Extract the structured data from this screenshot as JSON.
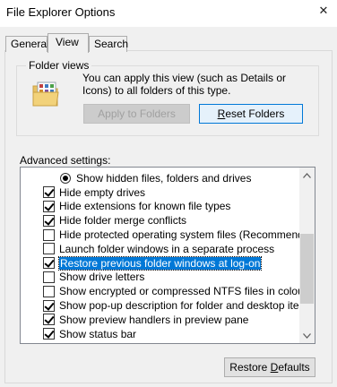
{
  "window": {
    "title": "File Explorer Options",
    "close_glyph": "✕"
  },
  "tabs": [
    {
      "label": "General",
      "active": false
    },
    {
      "label": "View",
      "active": true
    },
    {
      "label": "Search",
      "active": false
    }
  ],
  "folder_views": {
    "group_label": "Folder views",
    "description": "You can apply this view (such as Details or Icons) to all folders of this type.",
    "apply_button": {
      "label": "Apply to Folders",
      "enabled": false
    },
    "reset_button": {
      "prefix": "",
      "accel": "R",
      "rest": "eset Folders"
    },
    "icon": "folder-view-icon"
  },
  "advanced": {
    "label": "Advanced settings:",
    "items": [
      {
        "type": "radio",
        "checked": true,
        "label": "Show hidden files, folders and drives"
      },
      {
        "type": "checkbox",
        "checked": true,
        "label": "Hide empty drives"
      },
      {
        "type": "checkbox",
        "checked": true,
        "label": "Hide extensions for known file types"
      },
      {
        "type": "checkbox",
        "checked": true,
        "label": "Hide folder merge conflicts"
      },
      {
        "type": "checkbox",
        "checked": false,
        "label": "Hide protected operating system files (Recommended)"
      },
      {
        "type": "checkbox",
        "checked": false,
        "label": "Launch folder windows in a separate process"
      },
      {
        "type": "checkbox",
        "checked": true,
        "label": "Restore previous folder windows at log-on",
        "selected": true
      },
      {
        "type": "checkbox",
        "checked": false,
        "label": "Show drive letters"
      },
      {
        "type": "checkbox",
        "checked": false,
        "label": "Show encrypted or compressed NTFS files in colour"
      },
      {
        "type": "checkbox",
        "checked": true,
        "label": "Show pop-up description for folder and desktop items"
      },
      {
        "type": "checkbox",
        "checked": true,
        "label": "Show preview handlers in preview pane"
      },
      {
        "type": "checkbox",
        "checked": true,
        "label": "Show status bar"
      }
    ]
  },
  "restore_defaults": {
    "prefix": "Restore ",
    "accel": "D",
    "rest": "efaults"
  },
  "colors": {
    "selection": "#0078d7",
    "window_bg": "#f0f0f0"
  }
}
